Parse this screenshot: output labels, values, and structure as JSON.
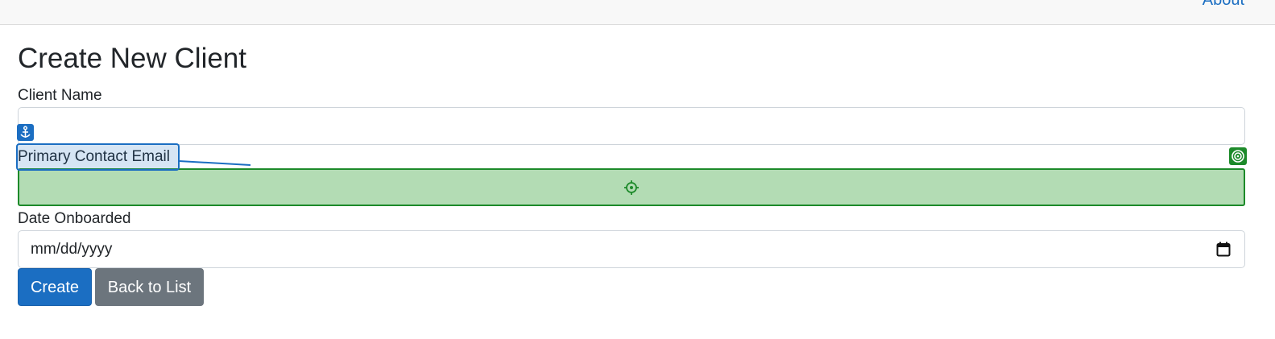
{
  "nav": {
    "about_label": "About"
  },
  "page": {
    "title": "Create New Client"
  },
  "form": {
    "client_name_label": "Client Name",
    "client_name_value": "",
    "email_label": "Primary Contact Email",
    "email_value": "",
    "date_label": "Date Onboarded",
    "date_placeholder": "mm/dd/yyyy"
  },
  "buttons": {
    "create_label": "Create",
    "back_label": "Back to List"
  },
  "colors": {
    "primary": "#1b6ec2",
    "secondary": "#6c757d",
    "target_green": "#1d8a2a",
    "target_fill": "#b3dcb4"
  },
  "annotations": {
    "anchor_icon": "anchor-icon",
    "target_icon": "target-icon",
    "crosshair_icon": "crosshair-icon"
  }
}
